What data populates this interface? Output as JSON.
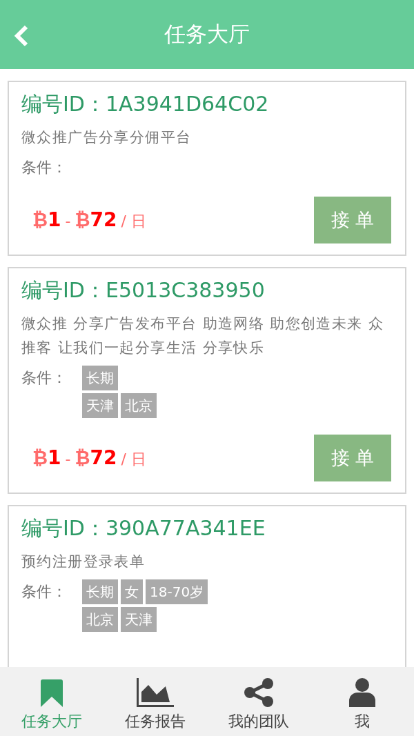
{
  "header": {
    "title": "任务大厅"
  },
  "tasks": [
    {
      "id_label": "编号ID：",
      "id": "1A3941D64C02",
      "description": "微众推广告分享分佣平台",
      "condition_label": "条件：",
      "price": {
        "symbol_min": "₿",
        "min": "1",
        "sep": "-",
        "symbol_max": "₿",
        "max": "72",
        "unit": "/ 日"
      },
      "button": "接 单"
    },
    {
      "id_label": "编号ID：",
      "id": "E5013C383950",
      "description": "微众推 分享广告发布平台 助造网络 助您创造未来 众推客 让我们一起分享生活 分享快乐",
      "condition_label": "条件：",
      "condition_rows": [
        [
          "长期"
        ],
        [
          "天津",
          "北京"
        ]
      ],
      "price": {
        "symbol_min": "₿",
        "min": "1",
        "sep": "-",
        "symbol_max": "₿",
        "max": "72",
        "unit": "/ 日"
      },
      "button": "接 单"
    },
    {
      "id_label": "编号ID：",
      "id": "390A77A341EE",
      "description": "预约注册登录表单",
      "condition_label": "条件：",
      "condition_rows": [
        [
          "长期",
          "女",
          "18-70岁"
        ],
        [
          "北京",
          "天津"
        ]
      ]
    }
  ],
  "tabbar": [
    {
      "kind": "bookmark",
      "label": "任务大厅",
      "selected": true
    },
    {
      "kind": "chart",
      "label": "任务报告",
      "selected": false
    },
    {
      "kind": "share",
      "label": "我的团队",
      "selected": false
    },
    {
      "kind": "person",
      "label": "我",
      "selected": false
    }
  ]
}
